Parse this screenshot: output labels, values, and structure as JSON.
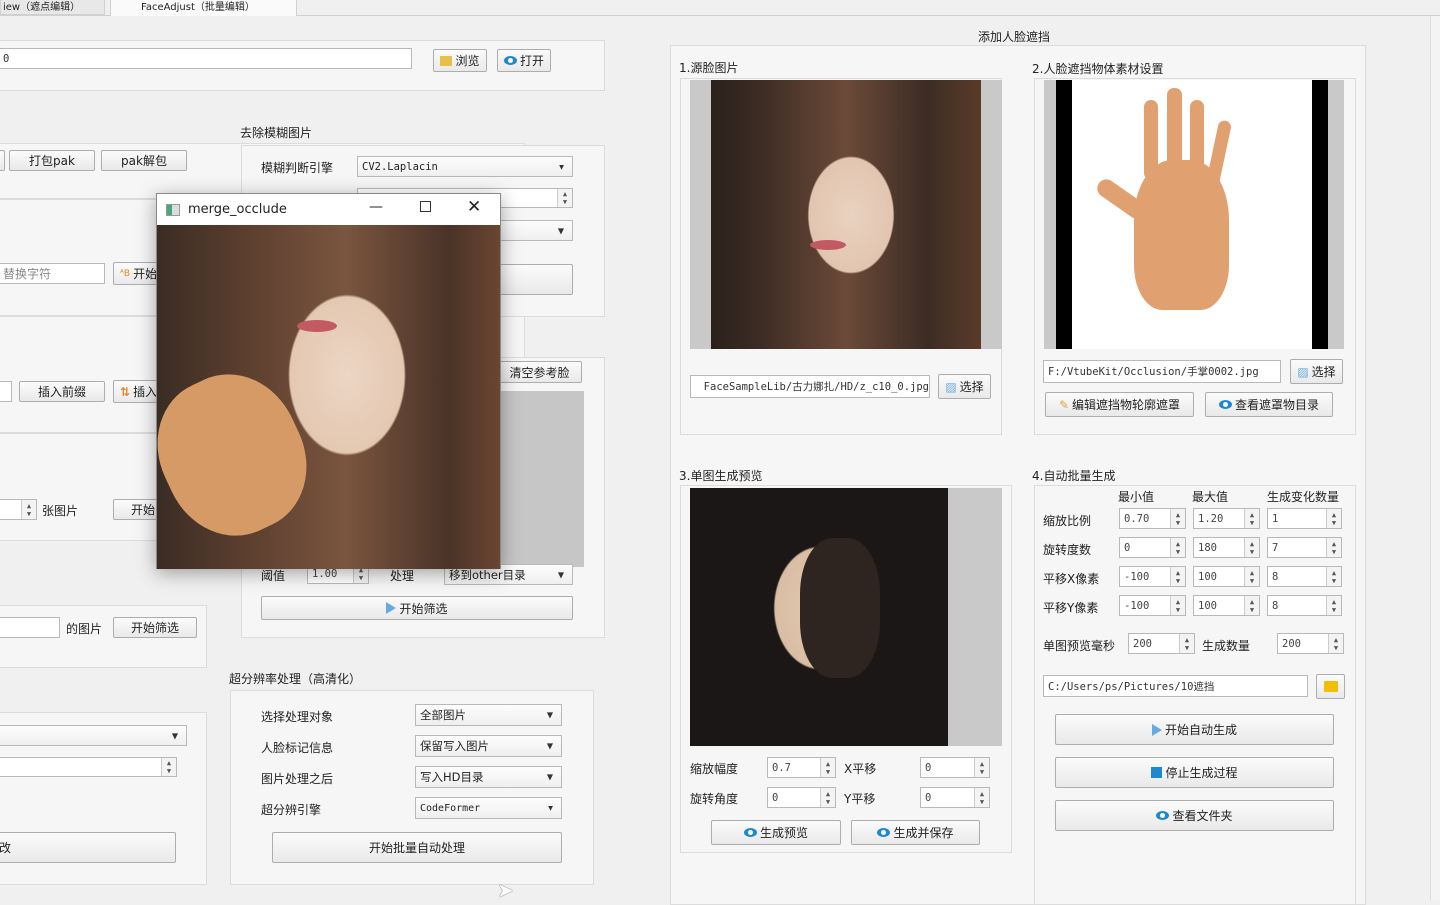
{
  "tabs": [
    "iew（遮点编辑）",
    "FaceAdjust（批量编辑）"
  ],
  "left": {
    "path_value": "0",
    "browse": "浏览",
    "open": "打开",
    "pack": "打包pak",
    "unpack": "pak解包",
    "replace_placeholder": "替换字符",
    "start_replace": "开始",
    "insert_prefix": "插入前缀",
    "insert_other": "插入",
    "images_suffix": "张图片",
    "start": "开始",
    "of_images": "的图片",
    "start_filter": "开始筛选",
    "bottom_btn": "改"
  },
  "blur": {
    "title": "去除模糊图片",
    "engine_label": "模糊判断引擎",
    "engine": "CV2.Laplacin"
  },
  "ref": {
    "clear": "清空参考脸",
    "threshold_label": "阈值",
    "threshold": "1.00",
    "process_label": "处理",
    "process": "移到other目录",
    "start": "开始筛选"
  },
  "sr": {
    "title": "超分辨率处理（高清化）",
    "rows": [
      {
        "label": "选择处理对象",
        "value": "全部图片"
      },
      {
        "label": "人脸标记信息",
        "value": "保留写入图片"
      },
      {
        "label": "图片处理之后",
        "value": "写入HD目录"
      },
      {
        "label": "超分辨引擎",
        "value": "CodeFormer"
      }
    ],
    "start": "开始批量自动处理"
  },
  "occ": {
    "title": "添加人脸遮挡",
    "s1": {
      "title": "1.源脸图片",
      "path": "FaceSampleLib/古力娜扎/HD/z_c10_0.jpg",
      "select": "选择"
    },
    "s2": {
      "title": "2.人脸遮挡物体素材设置",
      "path": "F:/VtubeKit/Occlusion/手掌0002.jpg",
      "select": "选择",
      "edit_mask": "编辑遮挡物轮廓遮罩",
      "view_dir": "查看遮罩物目录"
    },
    "s3": {
      "title": "3.单图生成预览",
      "scale_label": "缩放幅度",
      "scale": "0.7",
      "xshift_label": "X平移",
      "xshift": "0",
      "rot_label": "旋转角度",
      "rot": "0",
      "yshift_label": "Y平移",
      "yshift": "0",
      "preview": "生成预览",
      "save": "生成并保存"
    },
    "s4": {
      "title": "4.自动批量生成",
      "headers": [
        "最小值",
        "最大值",
        "生成变化数量"
      ],
      "rows": [
        {
          "label": "缩放比例",
          "min": "0.70",
          "max": "1.20",
          "count": "1"
        },
        {
          "label": "旋转度数",
          "min": "0",
          "max": "180",
          "count": "7"
        },
        {
          "label": "平移X像素",
          "min": "-100",
          "max": "100",
          "count": "8"
        },
        {
          "label": "平移Y像素",
          "min": "-100",
          "max": "100",
          "count": "8"
        }
      ],
      "preview_ms_label": "单图预览毫秒",
      "preview_ms": "200",
      "gen_count_label": "生成数量",
      "gen_count": "200",
      "out_path": "C:/Users/ps/Pictures/10遮挡",
      "start": "开始自动生成",
      "stop": "停止生成过程",
      "view": "查看文件夹"
    }
  },
  "popup": {
    "title": "merge_occlude"
  },
  "colors": {
    "accent": "#1e88d0",
    "stop": "#1e88d0",
    "folder": "#f0c000"
  }
}
